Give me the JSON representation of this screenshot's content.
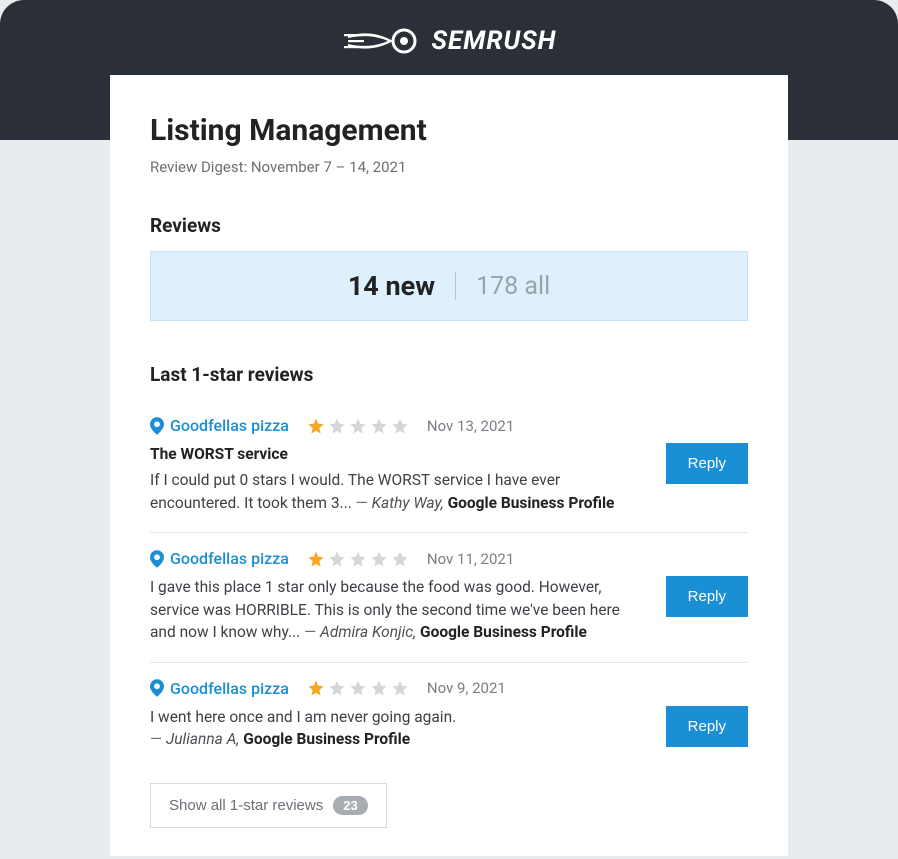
{
  "brand": "SEMRUSH",
  "page_title": "Listing Management",
  "subtitle": "Review Digest: November 7 – 14, 2021",
  "reviews_section_label": "Reviews",
  "stats": {
    "new_count": "14 new",
    "all_count": "178 all"
  },
  "last_section_label": "Last 1-star reviews",
  "reviews": [
    {
      "business": "Goodfellas pizza",
      "rating": 1,
      "date": "Nov 13, 2021",
      "title": "The WORST service",
      "body": "If I could put 0 stars I would. The WORST service I have ever encountered. It took them 3...",
      "author": "Kathy Way",
      "source": "Google Business Profile",
      "reply_label": "Reply"
    },
    {
      "business": "Goodfellas pizza",
      "rating": 1,
      "date": "Nov 11, 2021",
      "title": "",
      "body": "I gave this place 1 star only because the food was good. However, service was HORRIBLE. This is only the second time we've been here and now I know why...",
      "author": "Admira Konjic",
      "source": "Google Business Profile",
      "reply_label": "Reply"
    },
    {
      "business": "Goodfellas pizza",
      "rating": 1,
      "date": "Nov 9, 2021",
      "title": "",
      "body": "I went here once and I am never going again.",
      "author": "Julianna A",
      "source": "Google Business Profile",
      "reply_label": "Reply"
    }
  ],
  "show_all": {
    "label": "Show all 1-star reviews",
    "count": "23"
  }
}
